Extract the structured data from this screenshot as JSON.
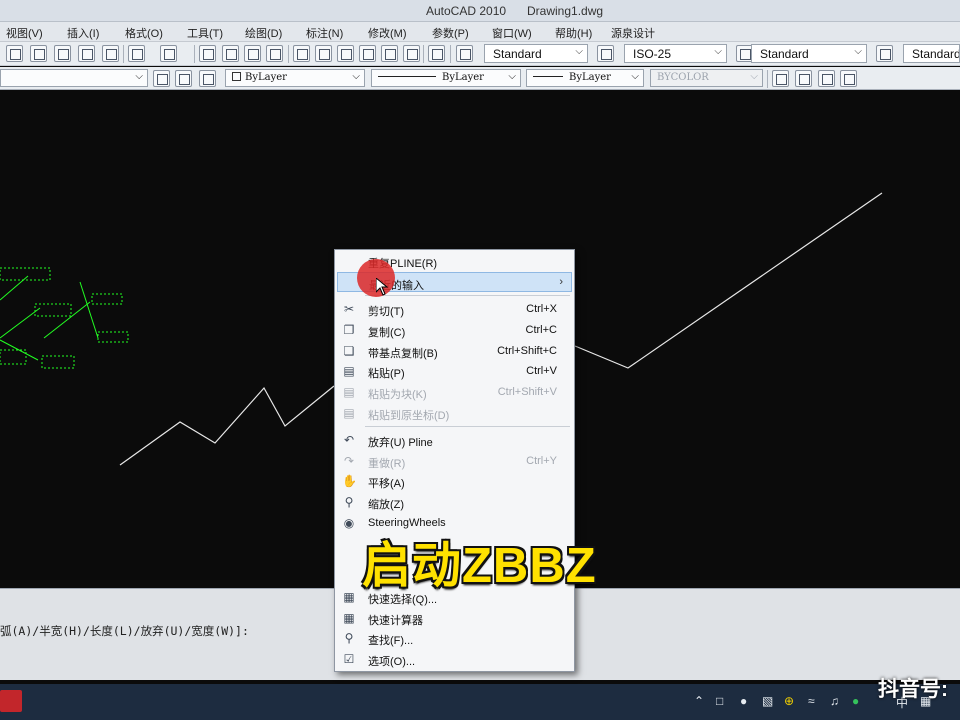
{
  "titlebar": {
    "app": "AutoCAD 2010",
    "file": "Drawing1.dwg"
  },
  "menubar": {
    "items": [
      "视图(V)",
      "插入(I)",
      "格式(O)",
      "工具(T)",
      "绘图(D)",
      "标注(N)",
      "修改(M)",
      "参数(P)",
      "窗口(W)",
      "帮助(H)",
      "源泉设计"
    ]
  },
  "toolbar1": {
    "text_style": "Standard",
    "dim_style": "ISO-25",
    "table_style": "Standard",
    "mleader_style": "Standard"
  },
  "toolbar2": {
    "color": "ByLayer",
    "linetype": "ByLayer",
    "lineweight": "ByLayer",
    "plotstyle": "BYCOLOR"
  },
  "command_line": {
    "prompt": "弧(A)/半宽(H)/长度(L)/放弃(U)/宽度(W)]:"
  },
  "context_menu": {
    "items": [
      {
        "label": "重复PLINE(R)",
        "shortcut": "",
        "icon": "repeat-icon",
        "enabled": true
      },
      {
        "label": "最近的输入",
        "shortcut": "",
        "icon": "",
        "enabled": true,
        "submenu": true,
        "highlighted": true
      },
      {
        "label": "剪切(T)",
        "shortcut": "Ctrl+X",
        "icon": "scissors-icon",
        "enabled": true
      },
      {
        "label": "复制(C)",
        "shortcut": "Ctrl+C",
        "icon": "copy-icon",
        "enabled": true
      },
      {
        "label": "带基点复制(B)",
        "shortcut": "Ctrl+Shift+C",
        "icon": "copy-base-icon",
        "enabled": true
      },
      {
        "label": "粘贴(P)",
        "shortcut": "Ctrl+V",
        "icon": "paste-icon",
        "enabled": true
      },
      {
        "label": "粘贴为块(K)",
        "shortcut": "Ctrl+Shift+V",
        "icon": "paste-block-icon",
        "enabled": false
      },
      {
        "label": "粘贴到原坐标(D)",
        "shortcut": "",
        "icon": "paste-orig-icon",
        "enabled": false
      },
      {
        "label": "放弃(U) Pline",
        "shortcut": "",
        "icon": "undo-icon",
        "enabled": true
      },
      {
        "label": "重做(R)",
        "shortcut": "Ctrl+Y",
        "icon": "redo-icon",
        "enabled": false
      },
      {
        "label": "平移(A)",
        "shortcut": "",
        "icon": "pan-icon",
        "enabled": true
      },
      {
        "label": "缩放(Z)",
        "shortcut": "",
        "icon": "zoom-icon",
        "enabled": true
      },
      {
        "label": "SteeringWheels",
        "shortcut": "",
        "icon": "wheel-icon",
        "enabled": true
      },
      {
        "label": "快速选择(Q)...",
        "shortcut": "",
        "icon": "quick-select-icon",
        "enabled": true
      },
      {
        "label": "快速计算器",
        "shortcut": "",
        "icon": "calculator-icon",
        "enabled": true
      },
      {
        "label": "查找(F)...",
        "shortcut": "",
        "icon": "find-icon",
        "enabled": true
      },
      {
        "label": "选项(O)...",
        "shortcut": "",
        "icon": "options-icon",
        "enabled": true
      }
    ]
  },
  "overlay": {
    "caption": "启动ZBBZ"
  },
  "watermark": {
    "text": "抖音号:"
  },
  "taskbar": {
    "ime": "中"
  },
  "colors": {
    "canvas_bg": "#0b0b0b",
    "polyline": "#e8e8e8",
    "annotation_green": "#22ff22",
    "caption_yellow": "#ffe100",
    "menu_highlight": "#cfe3f7"
  }
}
